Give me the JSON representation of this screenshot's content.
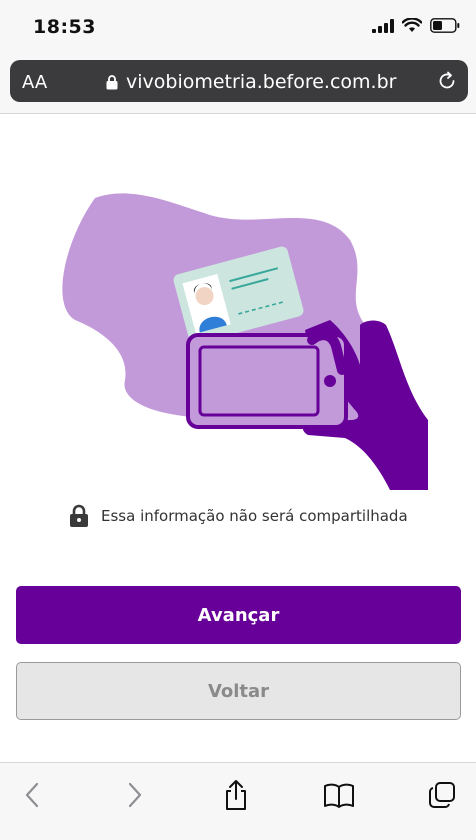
{
  "status": {
    "time": "18:53"
  },
  "browser": {
    "text_size_label": "AA",
    "url": "vivobiometria.before.com.br"
  },
  "content": {
    "privacy_note": "Essa informação não será compartilhada",
    "colors": {
      "brand_purple": "#660099",
      "blob_lilac": "#c39ad9",
      "card_mint": "#cce6df",
      "avatar_blue": "#2f7ed8"
    }
  },
  "actions": {
    "next_label": "Avançar",
    "back_label": "Voltar"
  },
  "toolbar": {
    "icons": [
      "back-icon",
      "forward-icon",
      "share-icon",
      "bookmarks-icon",
      "tabs-icon"
    ]
  }
}
